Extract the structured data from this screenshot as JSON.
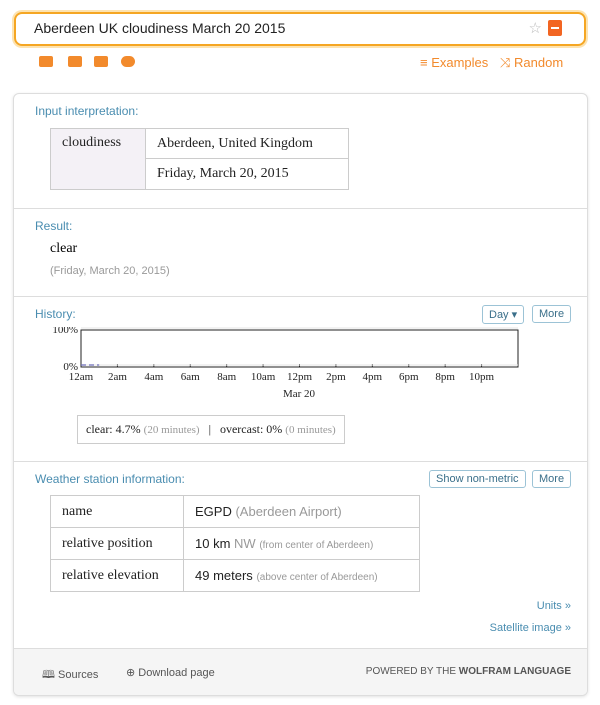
{
  "search": {
    "query": "Aberdeen UK cloudiness March 20 2015"
  },
  "toolbar": {
    "examples": "Examples",
    "random": "Random"
  },
  "input_interpretation": {
    "label": "Input interpretation:",
    "property": "cloudiness",
    "location": "Aberdeen, United Kingdom",
    "date": "Friday, March 20, 2015"
  },
  "result": {
    "label": "Result:",
    "value": "clear",
    "date": "(Friday, March 20, 2015)"
  },
  "history": {
    "label": "History:",
    "range_select": "Day",
    "more": "More",
    "summary": {
      "clear_label": "clear:",
      "clear_pct": "4.7%",
      "clear_time": "(20 minutes)",
      "sep": "|",
      "overcast_label": "overcast:",
      "overcast_pct": "0%",
      "overcast_time": "(0 minutes)"
    }
  },
  "chart_data": {
    "type": "line",
    "xlabel": "Mar 20",
    "x_ticks": [
      "12am",
      "2am",
      "4am",
      "6am",
      "8am",
      "10am",
      "12pm",
      "2pm",
      "4pm",
      "6pm",
      "8pm",
      "10pm"
    ],
    "y_ticks": [
      "0%",
      "100%"
    ],
    "xlim_hours": [
      0,
      24
    ],
    "ylim": [
      0,
      100
    ],
    "series": [
      {
        "style": "dashed",
        "color": "#6a6ab8",
        "x_hours": [
          0,
          1
        ],
        "values": [
          0,
          0
        ]
      }
    ]
  },
  "station": {
    "label": "Weather station information:",
    "show_non_metric": "Show non-metric",
    "more": "More",
    "rows": [
      {
        "key": "name",
        "value": "EGPD",
        "note": "(Aberdeen Airport)"
      },
      {
        "key": "relative position",
        "value": "10 km",
        "dir": "NW",
        "note": "(from center of Aberdeen)"
      },
      {
        "key": "relative elevation",
        "value": "49 meters",
        "note": "(above center of Aberdeen)"
      }
    ],
    "units_link": "Units »",
    "satellite_link": "Satellite image »"
  },
  "footer": {
    "sources": "Sources",
    "download": "Download page",
    "powered": "POWERED BY THE",
    "brand": "WOLFRAM LANGUAGE"
  }
}
